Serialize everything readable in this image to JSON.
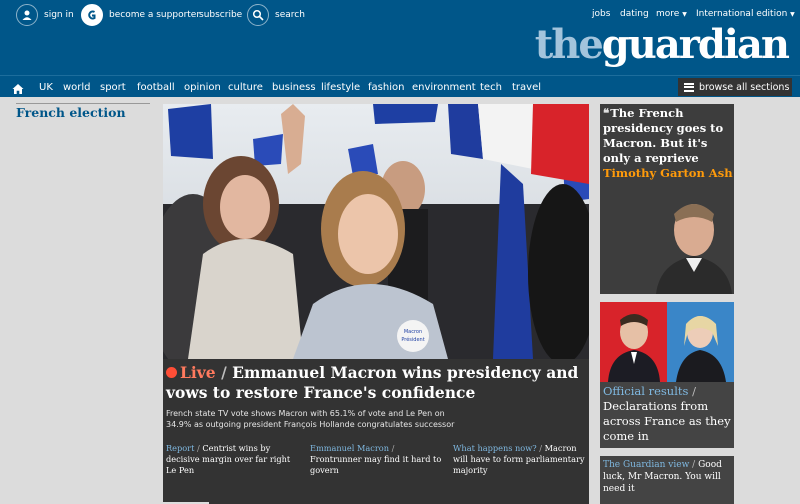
{
  "topbar": {
    "sign_in": "sign in",
    "become_supporter": "become a supporter",
    "subscribe": "subscribe",
    "search": "search",
    "jobs": "jobs",
    "dating": "dating",
    "more": "more",
    "edition": "International edition"
  },
  "logo": {
    "the": "the",
    "guardian": "guardian"
  },
  "nav": {
    "items": [
      "UK",
      "world",
      "sport",
      "football",
      "opinion",
      "culture",
      "business",
      "lifestyle",
      "fashion",
      "environment",
      "tech",
      "travel"
    ],
    "browse": "browse all sections"
  },
  "section": {
    "label": "French election"
  },
  "main": {
    "live_label": "Live",
    "slash": "/",
    "headline": "Emmanuel Macron wins presidency and vows to restore France's confidence",
    "standfirst": "French state TV vote shows Macron with 65.1% of vote and Le Pen on 34.9% as outgoing president François Hollande congratulates successor",
    "sub_links": [
      {
        "kicker": "Report",
        "sep": "/",
        "text": "Centrist wins by decisive margin over far right Le Pen"
      },
      {
        "kicker": "Emmanuel Macron",
        "sep": "/",
        "text": "Frontrunner may find it hard to govern"
      },
      {
        "kicker": "What happens now?",
        "sep": "/",
        "text": "Macron will have to form parliamentary majority"
      }
    ],
    "badge_line1": "Macron",
    "badge_line2": "Président"
  },
  "cards": {
    "opinion": {
      "quote_mark": "❝",
      "title": "The French presidency goes to Macron. But it's only a reprieve",
      "byline": "Timothy Garton Ash"
    },
    "results": {
      "kicker": "Official results",
      "sep": "/",
      "title": "Declarations from across France as they come in"
    },
    "view": {
      "kicker": "The Guardian view",
      "sep": "/",
      "title": "Good luck, Mr Macron. You will need it"
    }
  },
  "colors": {
    "brand_blue": "#005689",
    "live_red": "#ff4e36",
    "kicker_blue": "#7fb8e0",
    "byline_orange": "#ff9b0b",
    "card_dark": "#333333"
  }
}
